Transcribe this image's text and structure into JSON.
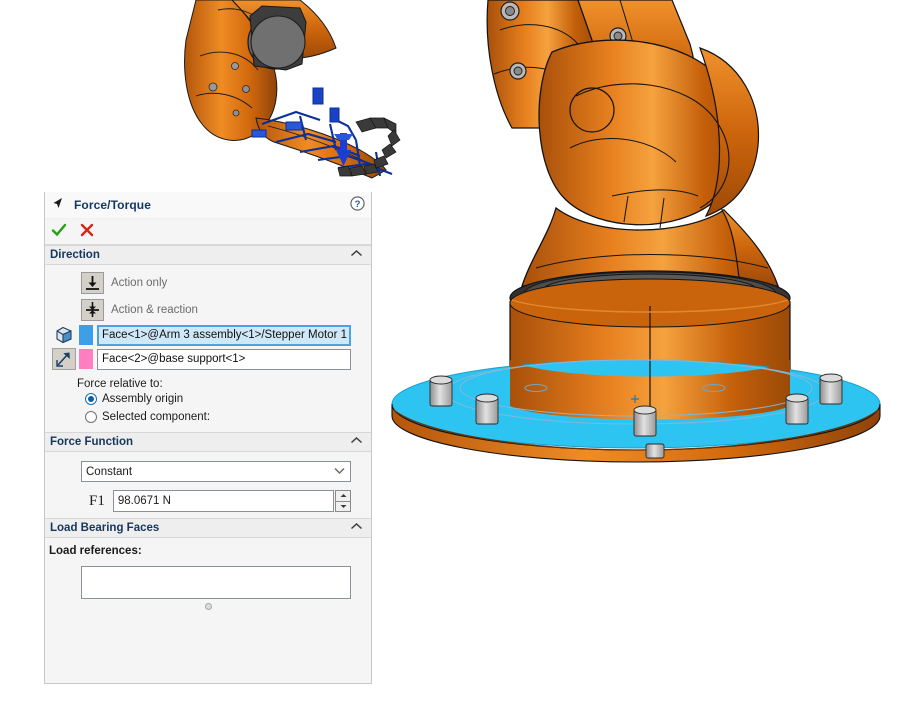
{
  "panel": {
    "title": "Force/Torque",
    "icons": {
      "title_icon": "cursor-arrow-icon",
      "help": "help-icon",
      "accept": "green-check-icon",
      "cancel": "red-x-icon"
    },
    "sections": {
      "direction": {
        "title": "Direction",
        "collapse": "chevron-up-icon",
        "options": [
          {
            "label": "Action only",
            "icon": "action-only-icon"
          },
          {
            "label": "Action & reaction",
            "icon": "action-reaction-icon"
          }
        ],
        "selections": [
          {
            "icon": "face-cube-icon",
            "swatch": "#3c9fe8",
            "value": "Face<1>@Arm 3 assembly<1>/Stepper Motor 1",
            "active": true
          },
          {
            "icon": "direction-arrow-icon",
            "swatch": "#ff7ec0",
            "value": "Face<2>@base support<1>",
            "active": false
          }
        ],
        "relative_label": "Force relative to:",
        "radios": [
          {
            "label": "Assembly origin",
            "selected": true
          },
          {
            "label": "Selected component:",
            "selected": false
          }
        ]
      },
      "force_function": {
        "title": "Force Function",
        "collapse": "chevron-up-icon",
        "function_value": "Constant",
        "function_arrow": "chevron-down-icon",
        "magnitude_label": "F1",
        "magnitude_value": "98.0671 N",
        "spin_up": "spin-up-icon",
        "spin_down": "spin-down-icon"
      },
      "load_bearing": {
        "title": "Load Bearing Faces",
        "collapse": "chevron-up-icon",
        "references_label": "Load references:",
        "references_value": "",
        "resize_handle": "resize-dot-icon"
      }
    }
  },
  "viewport": {
    "model_name": "robot-arm-assembly",
    "colors": {
      "robot_orange": "#d2690d",
      "robot_orange_light": "#f08a2a",
      "highlight_cyan": "#2ec4f2",
      "dark_gray": "#4a4a4a",
      "force_arrow_blue": "#1a3fd0"
    }
  }
}
